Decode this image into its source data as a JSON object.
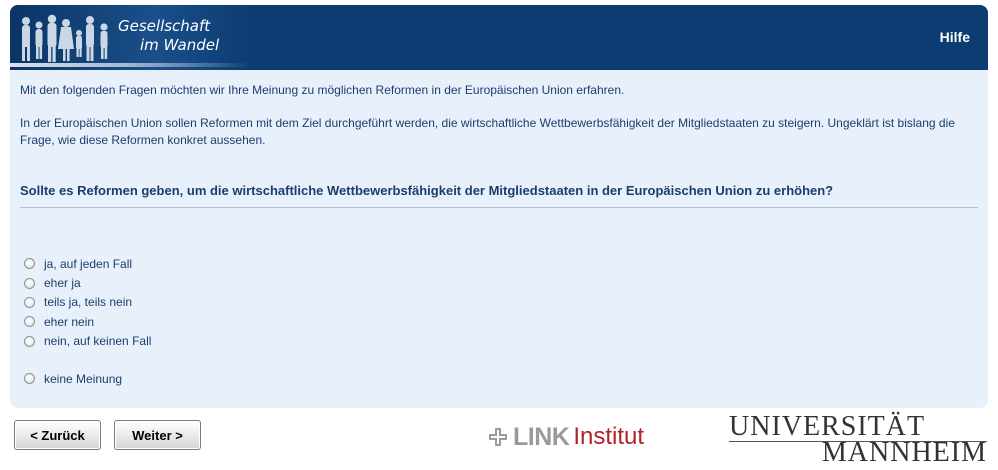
{
  "header": {
    "logo_line1": "Gesellschaft",
    "logo_line2": "im Wandel",
    "help_label": "Hilfe"
  },
  "intro": {
    "paragraph1": "Mit den folgenden Fragen möchten wir Ihre Meinung zu möglichen Reformen in der Europäischen Union erfahren.",
    "paragraph2": "In der Europäischen Union sollen Reformen mit dem Ziel durchgeführt werden, die wirtschaftliche Wettbewerbsfähigkeit der Mitgliedstaaten zu steigern. Ungeklärt ist bislang die Frage, wie diese Reformen konkret aussehen."
  },
  "question": "Sollte es Reformen geben, um die wirtschaftliche Wettbewerbsfähigkeit der Mitgliedstaaten in der Europäischen Union zu erhöhen?",
  "options": [
    {
      "label": "ja, auf jeden Fall"
    },
    {
      "label": "eher ja"
    },
    {
      "label": "teils ja, teils nein"
    },
    {
      "label": "eher nein"
    },
    {
      "label": "nein, auf keinen Fall"
    },
    {
      "label": "keine Meinung"
    }
  ],
  "nav": {
    "back_label": "< Zurück",
    "next_label": "Weiter >"
  },
  "logos": {
    "link_word": "LINK",
    "institut_word": "Institut",
    "uni_line1": "UNIVERSITÄT",
    "uni_line2": "MANNHEIM"
  },
  "colors": {
    "header_bg": "#0c3d72",
    "content_bg": "#e8f1fb",
    "text": "#1a3d6e",
    "link_red": "#b2202a"
  }
}
